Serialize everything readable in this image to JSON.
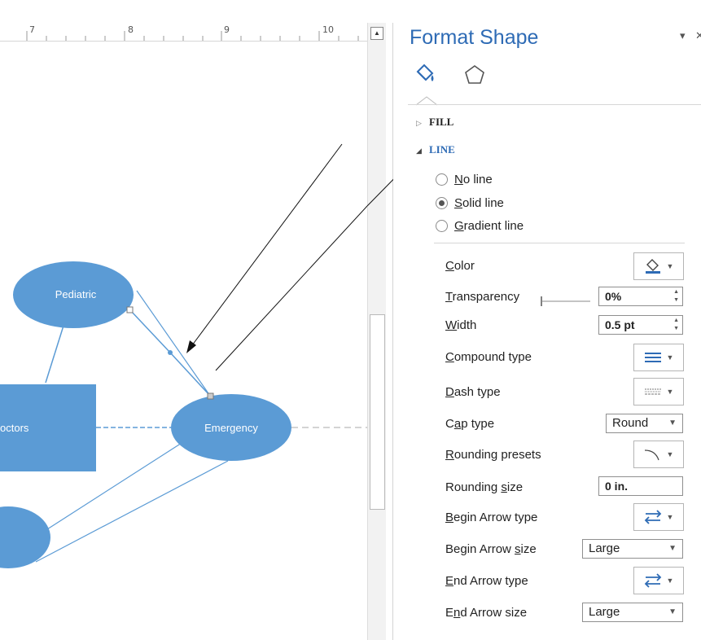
{
  "ruler": {
    "numbers": [
      "7",
      "8",
      "9",
      "10"
    ]
  },
  "diagram": {
    "shapes": {
      "pediatric": "Pediatric",
      "doctors": "octors",
      "emergency": "Emergency"
    }
  },
  "pane": {
    "title": "Format Shape",
    "pin_glyph": "▾",
    "close_glyph": "✕",
    "sections": {
      "fill": "FILL",
      "line": "LINE"
    },
    "line_options": {
      "no_line_key": "N",
      "no_line_rest": "o line",
      "solid_key": "S",
      "solid_rest": "olid line",
      "gradient_key": "G",
      "gradient_rest": "radient line"
    },
    "properties": {
      "color_key": "C",
      "color_rest": "olor",
      "transparency_key": "T",
      "transparency_rest": "ransparency",
      "transparency_value": "0%",
      "width_key": "W",
      "width_rest": "idth",
      "width_value": "0.5 pt",
      "compound_key": "C",
      "compound_rest": "ompound type",
      "dash_key": "D",
      "dash_rest": "ash type",
      "cap_pre": "C",
      "cap_key": "a",
      "cap_rest": "p type",
      "cap_value": "Round",
      "rounding_key": "R",
      "rounding_rest": "ounding presets",
      "rsize_pre": "Rounding ",
      "rsize_key": "s",
      "rsize_rest": "ize",
      "rsize_value": "0 in.",
      "begin_type_key": "B",
      "begin_type_rest": "egin Arrow type",
      "begin_size_pre": "Begin Arrow ",
      "begin_size_key": "s",
      "begin_size_rest": "ize",
      "begin_size_value": "Large",
      "end_type_key": "E",
      "end_type_rest": "nd Arrow type",
      "end_size_pre": "E",
      "end_size_key": "n",
      "end_size_rest": "d Arrow size",
      "end_size_value": "Large"
    }
  },
  "colors": {
    "accent": "#2e6bb5",
    "shape_fill": "#5b9bd5",
    "connector": "#5b9bd5"
  }
}
